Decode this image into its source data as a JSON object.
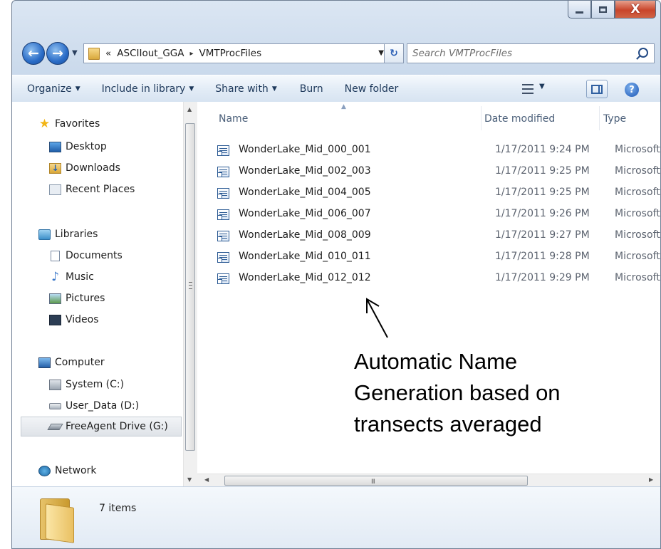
{
  "window": {
    "caption_buttons": {
      "minimize": "minimize-icon",
      "maximize": "maximize-icon",
      "close": "X"
    }
  },
  "address": {
    "overflow": "«",
    "crumbs": [
      "ASCIIout_GGA",
      "VMTProcFiles"
    ],
    "separator": "▸",
    "search_placeholder": "Search VMTProcFiles"
  },
  "toolbar": {
    "organize": "Organize",
    "include_in_library": "Include in library",
    "share_with": "Share with",
    "burn": "Burn",
    "new_folder": "New folder"
  },
  "nav": {
    "favorites": "Favorites",
    "desktop": "Desktop",
    "downloads": "Downloads",
    "recent_places": "Recent Places",
    "libraries": "Libraries",
    "documents": "Documents",
    "music": "Music",
    "pictures": "Pictures",
    "videos": "Videos",
    "computer": "Computer",
    "system": "System (C:)",
    "user_data": "User_Data (D:)",
    "freeagent": "FreeAgent Drive (G:)",
    "network": "Network"
  },
  "columns": {
    "name": "Name",
    "date_modified": "Date modified",
    "type": "Type"
  },
  "files": [
    {
      "name": "WonderLake_Mid_000_001",
      "date": "1/17/2011 9:24 PM",
      "type": "Microsoft"
    },
    {
      "name": "WonderLake_Mid_002_003",
      "date": "1/17/2011 9:25 PM",
      "type": "Microsoft"
    },
    {
      "name": "WonderLake_Mid_004_005",
      "date": "1/17/2011 9:25 PM",
      "type": "Microsoft"
    },
    {
      "name": "WonderLake_Mid_006_007",
      "date": "1/17/2011 9:26 PM",
      "type": "Microsoft"
    },
    {
      "name": "WonderLake_Mid_008_009",
      "date": "1/17/2011 9:27 PM",
      "type": "Microsoft"
    },
    {
      "name": "WonderLake_Mid_010_011",
      "date": "1/17/2011 9:28 PM",
      "type": "Microsoft"
    },
    {
      "name": "WonderLake_Mid_012_012",
      "date": "1/17/2011 9:29 PM",
      "type": "Microsoft"
    }
  ],
  "annotation": {
    "lines": [
      "Automatic Name",
      "Generation based on",
      "transects averaged"
    ]
  },
  "details": {
    "item_count": "7 items"
  },
  "colors": {
    "accent": "#1e395b",
    "close_button": "#c9452b",
    "folder": "#e9c062"
  }
}
